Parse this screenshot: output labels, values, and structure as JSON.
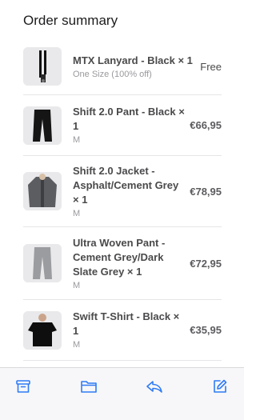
{
  "header": {
    "title": "Order summary"
  },
  "items": [
    {
      "name": "MTX Lanyard - Black × 1",
      "variant": "One Size (100% off)",
      "price": "Free",
      "thumb_icon": "lanyard-icon"
    },
    {
      "name": "Shift 2.0 Pant - Black × 1",
      "variant": "M",
      "price": "€66,95",
      "thumb_icon": "pants-icon"
    },
    {
      "name": "Shift 2.0 Jacket - Asphalt/Cement Grey × 1",
      "variant": "M",
      "price": "€78,95",
      "thumb_icon": "jacket-icon"
    },
    {
      "name": "Ultra Woven Pant - Cement Grey/Dark Slate Grey × 1",
      "variant": "M",
      "price": "€72,95",
      "thumb_icon": "pants-icon"
    },
    {
      "name": "Swift T-Shirt - Black × 1",
      "variant": "M",
      "price": "€35,95",
      "thumb_icon": "tshirt-icon"
    }
  ],
  "toolbar": {
    "icons": [
      "archive-icon",
      "folder-icon",
      "reply-icon",
      "compose-icon"
    ],
    "accent_color": "#2f7bf5"
  }
}
